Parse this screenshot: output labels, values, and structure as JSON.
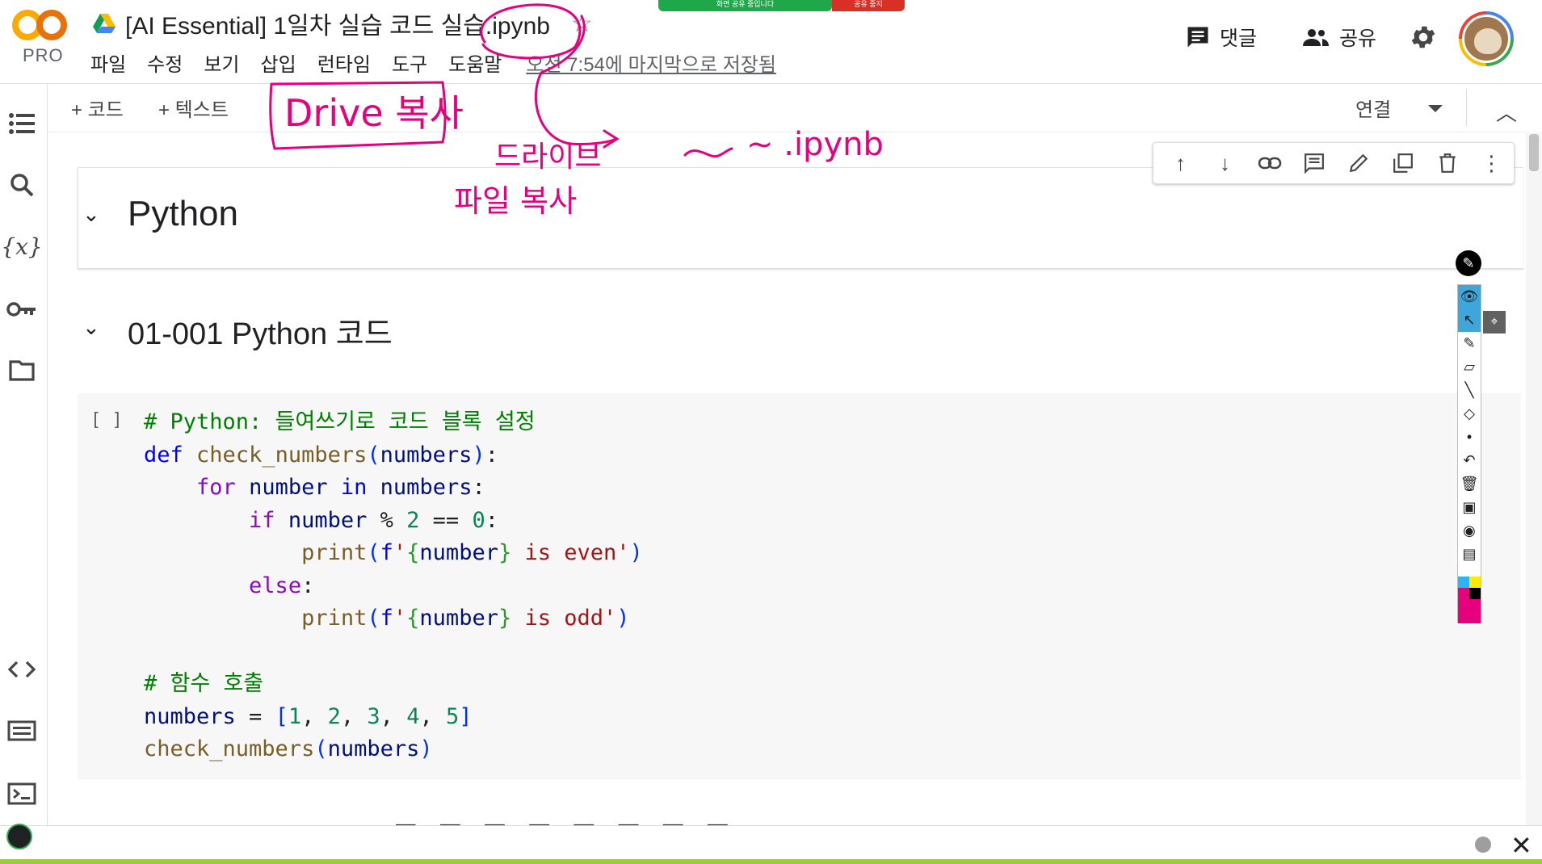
{
  "app": {
    "logo_text": "CO",
    "logo_badge": "PRO",
    "doc_title": "[AI Essential] 1일차 실습 코드 실습.ipynb",
    "share_banner": "화면 공유 중입니다",
    "share_stop": "공유 중지"
  },
  "menu": {
    "items": [
      "파일",
      "수정",
      "보기",
      "삽입",
      "런타임",
      "도구",
      "도움말"
    ],
    "saved_status": "오전 7:54에 마지막으로 저장됨"
  },
  "header_actions": {
    "comments_label": "댓글",
    "share_label": "공유"
  },
  "toolbar": {
    "add_code_label": "+ 코드",
    "add_text_label": "+ 텍스트",
    "connect_label": "연결"
  },
  "cells": {
    "heading1": "Python",
    "heading2": "01-001 Python 코드",
    "run_slot": "[ ]"
  },
  "code": {
    "comment1": "# Python: 들여쓰기로 코드 블록 설정",
    "comment2": "# 함수 호출"
  },
  "annotations": {
    "drive_copy": "Drive 복사",
    "drive_label": "드라이브",
    "file_copy": "파일 복사",
    "ipynb": "~ .ipynb"
  },
  "colors": {
    "ink": "#e6007e",
    "keyword": "#8f08c4",
    "def": "#0000ff",
    "string": "#a31515",
    "comment": "#008000"
  }
}
